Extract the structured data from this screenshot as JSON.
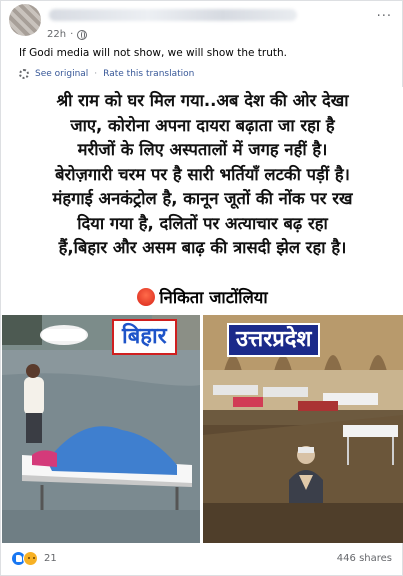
{
  "post": {
    "time": "22h",
    "text": "If Godi media will not show, we will show the truth.",
    "see_original": "See original",
    "separator": "·",
    "rate_translation": "Rate this translation",
    "more_label": "···"
  },
  "image": {
    "hindi_lines": [
      "श्री राम को घर मिल गया..अब देश की ओर देखा",
      "जाए, कोरोना अपना दायरा बढ़ाता जा रहा है",
      "मरीजों के लिए अस्पतालों में जगह नहीं है।",
      "बेरोज़गारी चरम पर है सारी भर्तियाँ लटकी पड़ीं है।",
      "मंहगाई अनकंट्रोल है, कानून जूतों की नोंक पर रख",
      "दिया गया है, दलितों पर अत्याचार बढ़ रहा",
      "हैं,बिहार और असम बाढ़ की त्रासदी झेल रहा है।"
    ],
    "author": "निकिता जाटोंलिया",
    "label_left": "बिहार",
    "label_right": "उत्तरप्रदेश"
  },
  "footer": {
    "reaction_count": "21",
    "shares": "446 shares"
  }
}
